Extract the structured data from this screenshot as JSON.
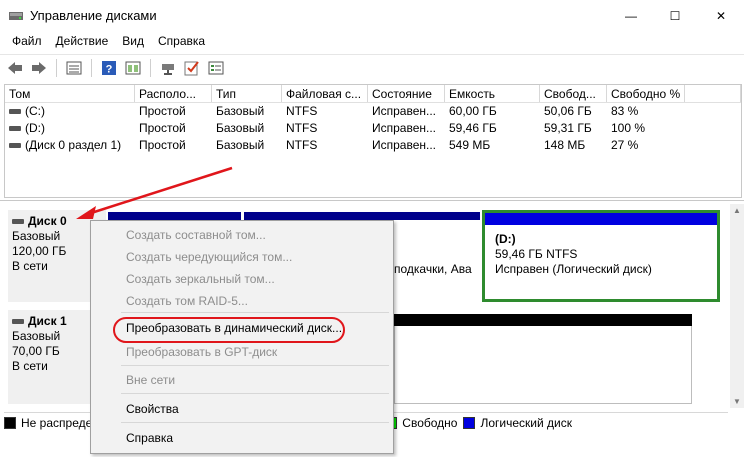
{
  "window": {
    "title": "Управление дисками",
    "controls": {
      "minimize": "—",
      "maximize": "☐",
      "close": "✕"
    }
  },
  "menu": [
    "Файл",
    "Действие",
    "Вид",
    "Справка"
  ],
  "toolbar": [
    "back-icon",
    "forward-icon",
    "properties-icon",
    "help-icon",
    "view-icon",
    "connect-icon",
    "check-icon",
    "settings-icon"
  ],
  "volumes": {
    "columns": [
      "Том",
      "Располо...",
      "Тип",
      "Файловая с...",
      "Состояние",
      "Емкость",
      "Свобод...",
      "Свободно %"
    ],
    "rows": [
      [
        "(C:)",
        "Простой",
        "Базовый",
        "NTFS",
        "Исправен...",
        "60,00 ГБ",
        "50,06 ГБ",
        "83 %"
      ],
      [
        "(D:)",
        "Простой",
        "Базовый",
        "NTFS",
        "Исправен...",
        "59,46 ГБ",
        "59,31 ГБ",
        "100 %"
      ],
      [
        "(Диск 0 раздел 1)",
        "Простой",
        "Базовый",
        "NTFS",
        "Исправен...",
        "549 МБ",
        "148 МБ",
        "27 %"
      ]
    ]
  },
  "disks": [
    {
      "name": "Диск 0",
      "type": "Базовый",
      "size": "120,00 ГБ",
      "status": "В сети"
    },
    {
      "name": "Диск 1",
      "type": "Базовый",
      "size": "70,00 ГБ",
      "status": "В сети"
    }
  ],
  "partitions": {
    "partial_text": "подкачки, Ава",
    "d_drive": {
      "name": "(D:)",
      "size": "59,46 ГБ NTFS",
      "status": "Исправен (Логический диск)"
    }
  },
  "legend": [
    {
      "label": "Не распреде",
      "color": "#000000"
    },
    {
      "label": "Свободно",
      "color": "#00e000"
    },
    {
      "label": "Логический диск",
      "color": "#0000e0"
    }
  ],
  "context_menu": {
    "items": [
      "Создать составной том...",
      "Создать чередующийся том...",
      "Создать зеркальный том...",
      "Создать том RAID-5...",
      "Преобразовать в динамический диск...",
      "Преобразовать в GPT-диск",
      "Вне сети",
      "Свойства",
      "Справка"
    ]
  },
  "colors": {
    "primary_stripe": "#00008b",
    "selection_border": "#2e8b2e",
    "highlight": "#e0161b"
  }
}
